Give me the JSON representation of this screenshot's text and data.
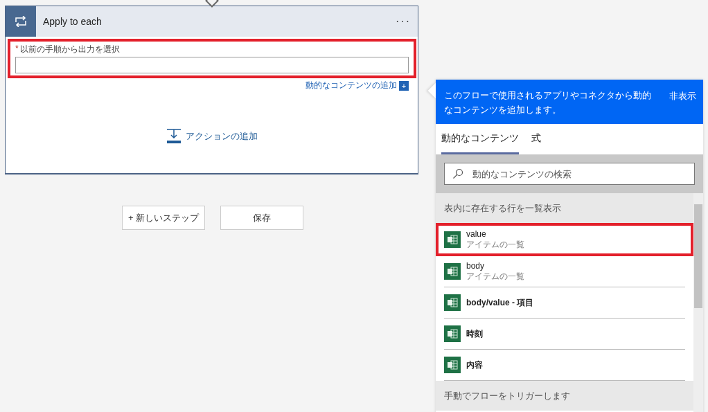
{
  "card": {
    "title": "Apply to each",
    "menu": "···",
    "field": {
      "label": "以前の手順から出力を選択",
      "required": "*",
      "highlighted": true
    },
    "dynamic_link": "動的なコンテンツの追加",
    "dynamic_link_icon": "+",
    "add_action": "アクションの追加"
  },
  "buttons": [
    "+ 新しいステップ",
    "保存"
  ],
  "panel": {
    "banner": "このフローで使用されるアプリやコネクタから動的なコンテンツを追加します。",
    "hide": "非表示",
    "tabs": [
      {
        "label": "動的なコンテンツ",
        "selected": true
      },
      {
        "label": "式",
        "selected": false
      }
    ],
    "search": {
      "placeholder": "動的なコンテンツの検索"
    },
    "sections": [
      {
        "title": "表内に存在する行を一覧表示",
        "items": [
          {
            "name": "value",
            "description": "アイテムの一覧",
            "highlighted": true
          },
          {
            "name": "body",
            "description": "アイテムの一覧",
            "highlighted": false
          },
          {
            "name": "body/value - 項目",
            "highlighted": false
          },
          {
            "name": "時刻",
            "highlighted": false
          },
          {
            "name": "内容",
            "highlighted": false
          }
        ]
      },
      {
        "title": "手動でフローをトリガーします"
      }
    ]
  }
}
